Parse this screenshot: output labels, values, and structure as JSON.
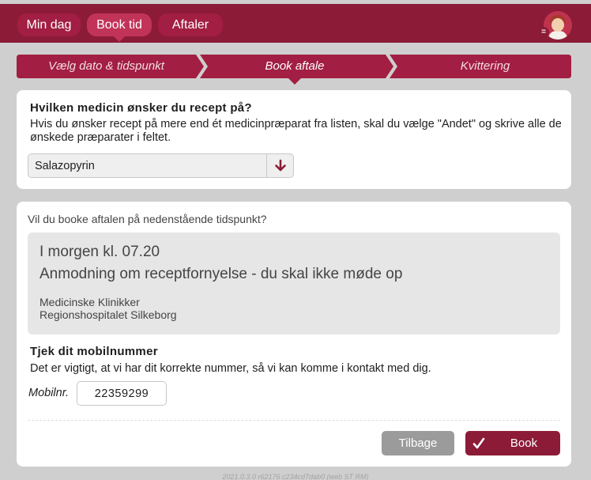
{
  "nav": {
    "items": [
      {
        "label": "Min dag"
      },
      {
        "label": "Book tid"
      },
      {
        "label": "Aftaler"
      }
    ],
    "active": "Book tid",
    "avatar_badge": "="
  },
  "steps": [
    {
      "label": "Vælg dato & tidspunkt"
    },
    {
      "label": "Book aftale"
    },
    {
      "label": "Kvittering"
    }
  ],
  "active_step": "Book aftale",
  "medicine": {
    "question": "Hvilken medicin ønsker du recept på?",
    "help": "Hvis du ønsker recept på mere end ét medicinpræparat fra listen, skal du vælge \"Andet\" og skrive alle de ønskede præparater i feltet.",
    "selected": "Salazopyrin"
  },
  "booking": {
    "intro": "Vil du booke aftalen på nedenstående tidspunkt?",
    "when": "I morgen kl. 07.20",
    "what": "Anmodning om receptfornyelse - du skal ikke møde op",
    "clinic": "Medicinske Klinikker",
    "hospital": "Regionshospitalet Silkeborg"
  },
  "phone": {
    "heading": "Tjek dit mobilnummer",
    "help": "Det er vigtigt, at vi har dit korrekte nummer, så vi kan komme i kontakt med dig.",
    "label": "Mobilnr.",
    "value": "22359299"
  },
  "actions": {
    "back": "Tilbage",
    "book": "Book"
  },
  "footer": "2021.0.3.0 r62176 c234cd7dab0 (web ST RM)",
  "colors": {
    "brand": "#8c1b37",
    "brand_active": "#c23359",
    "back_button": "#9b9b9b"
  }
}
